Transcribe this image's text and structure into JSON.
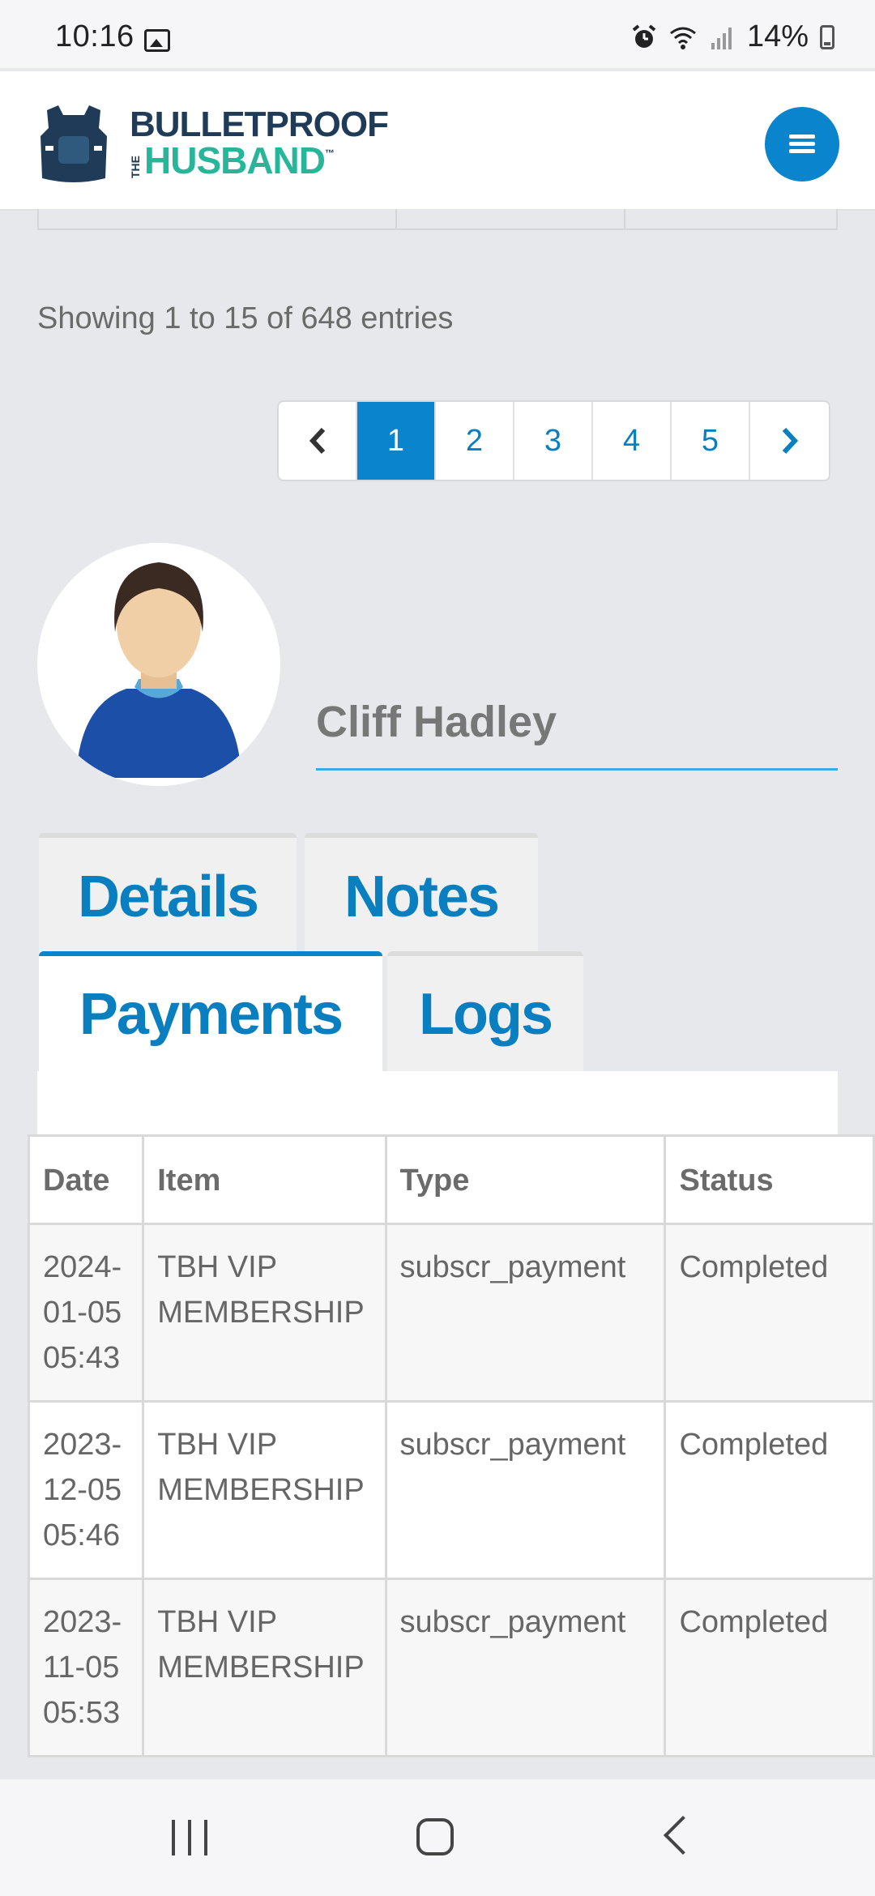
{
  "status_bar": {
    "time": "10:16",
    "battery": "14%"
  },
  "header": {
    "logo_top": "BULLETPROOF",
    "logo_the": "THE",
    "logo_bottom": "HUSBAND",
    "logo_tm": "™",
    "brand_color": "#1f3b57",
    "accent_color": "#27b69a",
    "menu_icon": "hamburger-icon"
  },
  "pagination": {
    "summary": "Showing 1 to 15 of 648 entries",
    "prev": "‹",
    "next": "›",
    "pages": [
      "1",
      "2",
      "3",
      "4",
      "5"
    ],
    "active_page": "1"
  },
  "profile": {
    "name": "Cliff Hadley"
  },
  "tabs": {
    "details": "Details",
    "notes": "Notes",
    "payments": "Payments",
    "logs": "Logs",
    "active": "Payments"
  },
  "payments_table": {
    "headers": [
      "Date",
      "Item",
      "Type",
      "Status"
    ],
    "rows": [
      {
        "date": "2024-\n01-05\n05:43",
        "item": "TBH VIP\nMEMBERSHIP",
        "type": "subscr_payment",
        "status": "Completed"
      },
      {
        "date": "2023-\n12-05\n05:46",
        "item": "TBH VIP\nMEMBERSHIP",
        "type": "subscr_payment",
        "status": "Completed"
      },
      {
        "date": "2023-\n11-05\n05:53",
        "item": "TBH VIP\nMEMBERSHIP",
        "type": "subscr_payment",
        "status": "Completed"
      }
    ]
  }
}
